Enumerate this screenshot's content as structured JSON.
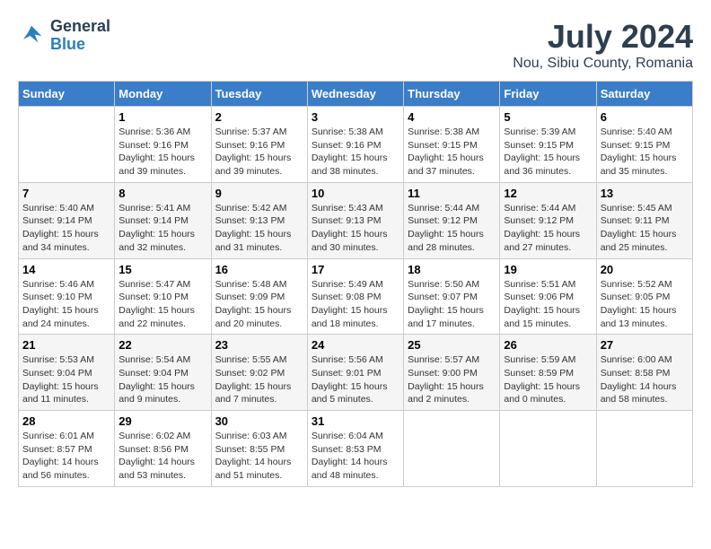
{
  "header": {
    "logo_line1": "General",
    "logo_line2": "Blue",
    "title": "July 2024",
    "subtitle": "Nou, Sibiu County, Romania"
  },
  "calendar": {
    "weekdays": [
      "Sunday",
      "Monday",
      "Tuesday",
      "Wednesday",
      "Thursday",
      "Friday",
      "Saturday"
    ],
    "weeks": [
      [
        {
          "day": "",
          "lines": []
        },
        {
          "day": "1",
          "lines": [
            "Sunrise: 5:36 AM",
            "Sunset: 9:16 PM",
            "Daylight: 15 hours",
            "and 39 minutes."
          ]
        },
        {
          "day": "2",
          "lines": [
            "Sunrise: 5:37 AM",
            "Sunset: 9:16 PM",
            "Daylight: 15 hours",
            "and 39 minutes."
          ]
        },
        {
          "day": "3",
          "lines": [
            "Sunrise: 5:38 AM",
            "Sunset: 9:16 PM",
            "Daylight: 15 hours",
            "and 38 minutes."
          ]
        },
        {
          "day": "4",
          "lines": [
            "Sunrise: 5:38 AM",
            "Sunset: 9:15 PM",
            "Daylight: 15 hours",
            "and 37 minutes."
          ]
        },
        {
          "day": "5",
          "lines": [
            "Sunrise: 5:39 AM",
            "Sunset: 9:15 PM",
            "Daylight: 15 hours",
            "and 36 minutes."
          ]
        },
        {
          "day": "6",
          "lines": [
            "Sunrise: 5:40 AM",
            "Sunset: 9:15 PM",
            "Daylight: 15 hours",
            "and 35 minutes."
          ]
        }
      ],
      [
        {
          "day": "7",
          "lines": [
            "Sunrise: 5:40 AM",
            "Sunset: 9:14 PM",
            "Daylight: 15 hours",
            "and 34 minutes."
          ]
        },
        {
          "day": "8",
          "lines": [
            "Sunrise: 5:41 AM",
            "Sunset: 9:14 PM",
            "Daylight: 15 hours",
            "and 32 minutes."
          ]
        },
        {
          "day": "9",
          "lines": [
            "Sunrise: 5:42 AM",
            "Sunset: 9:13 PM",
            "Daylight: 15 hours",
            "and 31 minutes."
          ]
        },
        {
          "day": "10",
          "lines": [
            "Sunrise: 5:43 AM",
            "Sunset: 9:13 PM",
            "Daylight: 15 hours",
            "and 30 minutes."
          ]
        },
        {
          "day": "11",
          "lines": [
            "Sunrise: 5:44 AM",
            "Sunset: 9:12 PM",
            "Daylight: 15 hours",
            "and 28 minutes."
          ]
        },
        {
          "day": "12",
          "lines": [
            "Sunrise: 5:44 AM",
            "Sunset: 9:12 PM",
            "Daylight: 15 hours",
            "and 27 minutes."
          ]
        },
        {
          "day": "13",
          "lines": [
            "Sunrise: 5:45 AM",
            "Sunset: 9:11 PM",
            "Daylight: 15 hours",
            "and 25 minutes."
          ]
        }
      ],
      [
        {
          "day": "14",
          "lines": [
            "Sunrise: 5:46 AM",
            "Sunset: 9:10 PM",
            "Daylight: 15 hours",
            "and 24 minutes."
          ]
        },
        {
          "day": "15",
          "lines": [
            "Sunrise: 5:47 AM",
            "Sunset: 9:10 PM",
            "Daylight: 15 hours",
            "and 22 minutes."
          ]
        },
        {
          "day": "16",
          "lines": [
            "Sunrise: 5:48 AM",
            "Sunset: 9:09 PM",
            "Daylight: 15 hours",
            "and 20 minutes."
          ]
        },
        {
          "day": "17",
          "lines": [
            "Sunrise: 5:49 AM",
            "Sunset: 9:08 PM",
            "Daylight: 15 hours",
            "and 18 minutes."
          ]
        },
        {
          "day": "18",
          "lines": [
            "Sunrise: 5:50 AM",
            "Sunset: 9:07 PM",
            "Daylight: 15 hours",
            "and 17 minutes."
          ]
        },
        {
          "day": "19",
          "lines": [
            "Sunrise: 5:51 AM",
            "Sunset: 9:06 PM",
            "Daylight: 15 hours",
            "and 15 minutes."
          ]
        },
        {
          "day": "20",
          "lines": [
            "Sunrise: 5:52 AM",
            "Sunset: 9:05 PM",
            "Daylight: 15 hours",
            "and 13 minutes."
          ]
        }
      ],
      [
        {
          "day": "21",
          "lines": [
            "Sunrise: 5:53 AM",
            "Sunset: 9:04 PM",
            "Daylight: 15 hours",
            "and 11 minutes."
          ]
        },
        {
          "day": "22",
          "lines": [
            "Sunrise: 5:54 AM",
            "Sunset: 9:04 PM",
            "Daylight: 15 hours",
            "and 9 minutes."
          ]
        },
        {
          "day": "23",
          "lines": [
            "Sunrise: 5:55 AM",
            "Sunset: 9:02 PM",
            "Daylight: 15 hours",
            "and 7 minutes."
          ]
        },
        {
          "day": "24",
          "lines": [
            "Sunrise: 5:56 AM",
            "Sunset: 9:01 PM",
            "Daylight: 15 hours",
            "and 5 minutes."
          ]
        },
        {
          "day": "25",
          "lines": [
            "Sunrise: 5:57 AM",
            "Sunset: 9:00 PM",
            "Daylight: 15 hours",
            "and 2 minutes."
          ]
        },
        {
          "day": "26",
          "lines": [
            "Sunrise: 5:59 AM",
            "Sunset: 8:59 PM",
            "Daylight: 15 hours",
            "and 0 minutes."
          ]
        },
        {
          "day": "27",
          "lines": [
            "Sunrise: 6:00 AM",
            "Sunset: 8:58 PM",
            "Daylight: 14 hours",
            "and 58 minutes."
          ]
        }
      ],
      [
        {
          "day": "28",
          "lines": [
            "Sunrise: 6:01 AM",
            "Sunset: 8:57 PM",
            "Daylight: 14 hours",
            "and 56 minutes."
          ]
        },
        {
          "day": "29",
          "lines": [
            "Sunrise: 6:02 AM",
            "Sunset: 8:56 PM",
            "Daylight: 14 hours",
            "and 53 minutes."
          ]
        },
        {
          "day": "30",
          "lines": [
            "Sunrise: 6:03 AM",
            "Sunset: 8:55 PM",
            "Daylight: 14 hours",
            "and 51 minutes."
          ]
        },
        {
          "day": "31",
          "lines": [
            "Sunrise: 6:04 AM",
            "Sunset: 8:53 PM",
            "Daylight: 14 hours",
            "and 48 minutes."
          ]
        },
        {
          "day": "",
          "lines": []
        },
        {
          "day": "",
          "lines": []
        },
        {
          "day": "",
          "lines": []
        }
      ]
    ]
  }
}
